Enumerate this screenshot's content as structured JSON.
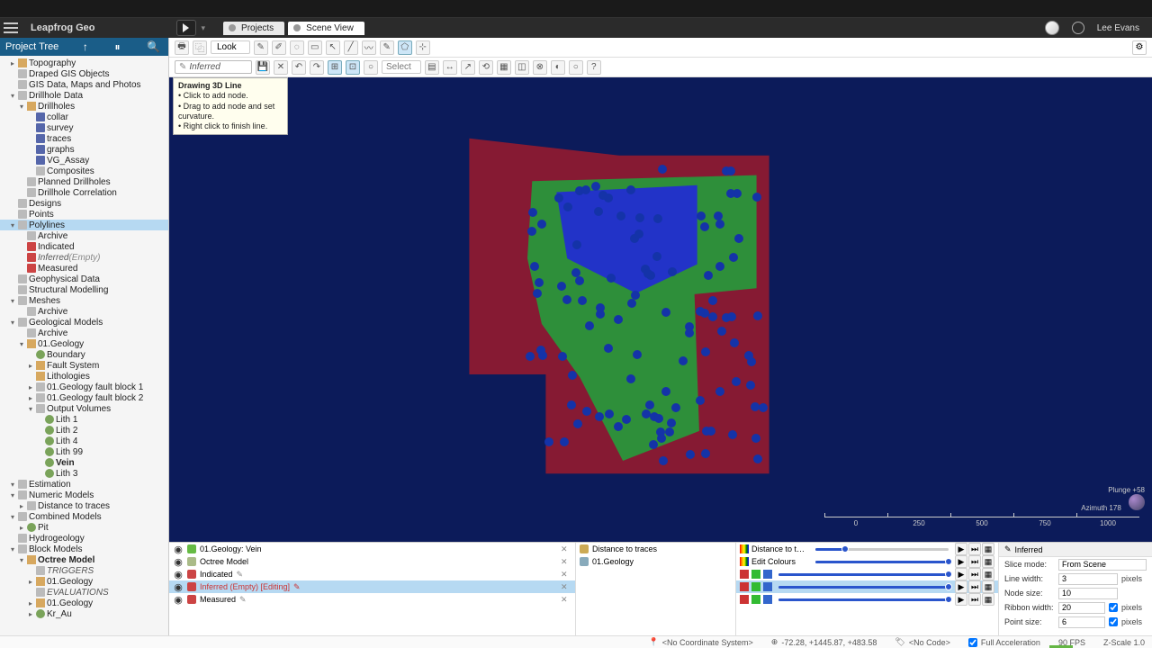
{
  "app": {
    "name": "Leapfrog Geo"
  },
  "tabs": {
    "projects": "Projects",
    "scene": "Scene View"
  },
  "user": {
    "name": "Lee Evans"
  },
  "tree": {
    "title": "Project Tree",
    "items": [
      {
        "d": 1,
        "t": "▸",
        "i": "folder",
        "l": "Topography"
      },
      {
        "d": 1,
        "t": "",
        "i": "",
        "l": "Draped GIS Objects"
      },
      {
        "d": 1,
        "t": "",
        "i": "",
        "l": "GIS Data, Maps and Photos"
      },
      {
        "d": 1,
        "t": "▾",
        "i": "",
        "l": "Drillhole Data"
      },
      {
        "d": 2,
        "t": "▾",
        "i": "folder",
        "l": "Drillholes"
      },
      {
        "d": 3,
        "t": "",
        "i": "blue",
        "l": "collar"
      },
      {
        "d": 3,
        "t": "",
        "i": "blue",
        "l": "survey"
      },
      {
        "d": 3,
        "t": "",
        "i": "blue",
        "l": "traces"
      },
      {
        "d": 3,
        "t": "",
        "i": "blue",
        "l": "graphs"
      },
      {
        "d": 3,
        "t": "",
        "i": "blue",
        "l": "VG_Assay"
      },
      {
        "d": 3,
        "t": "",
        "i": "",
        "l": "Composites"
      },
      {
        "d": 2,
        "t": "",
        "i": "",
        "l": "Planned Drillholes"
      },
      {
        "d": 2,
        "t": "",
        "i": "",
        "l": "Drillhole Correlation"
      },
      {
        "d": 1,
        "t": "",
        "i": "",
        "l": "Designs"
      },
      {
        "d": 1,
        "t": "",
        "i": "",
        "l": "Points"
      },
      {
        "d": 1,
        "t": "▾",
        "i": "",
        "l": "Polylines",
        "sel": true
      },
      {
        "d": 2,
        "t": "",
        "i": "",
        "l": "Archive"
      },
      {
        "d": 2,
        "t": "",
        "i": "line",
        "l": "Indicated"
      },
      {
        "d": 2,
        "t": "",
        "i": "line",
        "l": "Inferred",
        "suf": "(Empty)",
        "it": true
      },
      {
        "d": 2,
        "t": "",
        "i": "line",
        "l": "Measured"
      },
      {
        "d": 1,
        "t": "",
        "i": "",
        "l": "Geophysical Data"
      },
      {
        "d": 1,
        "t": "",
        "i": "",
        "l": "Structural Modelling"
      },
      {
        "d": 1,
        "t": "▾",
        "i": "",
        "l": "Meshes"
      },
      {
        "d": 2,
        "t": "",
        "i": "",
        "l": "Archive"
      },
      {
        "d": 1,
        "t": "▾",
        "i": "",
        "l": "Geological Models"
      },
      {
        "d": 2,
        "t": "",
        "i": "",
        "l": "Archive"
      },
      {
        "d": 2,
        "t": "▾",
        "i": "folder",
        "l": "01.Geology"
      },
      {
        "d": 3,
        "t": "",
        "i": "vol",
        "l": "Boundary"
      },
      {
        "d": 3,
        "t": "▸",
        "i": "folder",
        "l": "Fault System"
      },
      {
        "d": 3,
        "t": "",
        "i": "folder",
        "l": "Lithologies"
      },
      {
        "d": 3,
        "t": "▸",
        "i": "",
        "l": "01.Geology fault block 1"
      },
      {
        "d": 3,
        "t": "▸",
        "i": "",
        "l": "01.Geology fault block 2"
      },
      {
        "d": 3,
        "t": "▾",
        "i": "",
        "l": "Output Volumes"
      },
      {
        "d": 4,
        "t": "",
        "i": "vol",
        "l": "Lith 1"
      },
      {
        "d": 4,
        "t": "",
        "i": "vol",
        "l": "Lith 2"
      },
      {
        "d": 4,
        "t": "",
        "i": "vol",
        "l": "Lith 4"
      },
      {
        "d": 4,
        "t": "",
        "i": "vol",
        "l": "Lith 99"
      },
      {
        "d": 4,
        "t": "",
        "i": "vol",
        "l": "Vein",
        "bold": true
      },
      {
        "d": 4,
        "t": "",
        "i": "vol",
        "l": "Lith 3"
      },
      {
        "d": 1,
        "t": "▾",
        "i": "",
        "l": "Estimation"
      },
      {
        "d": 1,
        "t": "▾",
        "i": "",
        "l": "Numeric Models"
      },
      {
        "d": 2,
        "t": "▸",
        "i": "",
        "l": "Distance to traces"
      },
      {
        "d": 1,
        "t": "▾",
        "i": "",
        "l": "Combined Models"
      },
      {
        "d": 2,
        "t": "▸",
        "i": "vol",
        "l": "Pit"
      },
      {
        "d": 1,
        "t": "",
        "i": "",
        "l": "Hydrogeology"
      },
      {
        "d": 1,
        "t": "▾",
        "i": "",
        "l": "Block Models"
      },
      {
        "d": 2,
        "t": "▾",
        "i": "folder",
        "l": "Octree Model",
        "bold": true
      },
      {
        "d": 3,
        "t": "",
        "i": "",
        "l": "TRIGGERS",
        "it": true
      },
      {
        "d": 3,
        "t": "▸",
        "i": "folder",
        "l": "01.Geology"
      },
      {
        "d": 3,
        "t": "",
        "i": "",
        "l": "EVALUATIONS",
        "it": true
      },
      {
        "d": 3,
        "t": "▸",
        "i": "folder",
        "l": "01.Geology"
      },
      {
        "d": 3,
        "t": "▸",
        "i": "vol",
        "l": "Kr_Au"
      }
    ]
  },
  "toolbar1": {
    "look": "Look"
  },
  "toolbar2": {
    "input": "Inferred",
    "select": "Select"
  },
  "tooltip": {
    "title": "Drawing 3D Line",
    "l1": "• Click to add node.",
    "l2": "• Drag to add node and set curvature.",
    "l3": "• Right click to finish line."
  },
  "compass": {
    "plunge": "Plunge +58",
    "azimuth": "Azimuth 178"
  },
  "ruler": [
    "0",
    "250",
    "500",
    "750",
    "1000"
  ],
  "scene_list": [
    {
      "eye": "◉",
      "ic": "#6b4",
      "l": "01.Geology: Vein",
      "pen": "",
      "x": "✕"
    },
    {
      "eye": "◉",
      "ic": "#ab8",
      "l": "Octree Model",
      "pen": "",
      "x": "✕"
    },
    {
      "eye": "◉",
      "ic": "#c44",
      "l": "Indicated",
      "pen": "✎",
      "x": "✕"
    },
    {
      "eye": "◉",
      "ic": "#c44",
      "l": "Inferred (Empty) [Editing]",
      "pen": "✎",
      "x": "✕",
      "sel": true,
      "red": true
    },
    {
      "eye": "◉",
      "ic": "#c44",
      "l": "Measured",
      "pen": "✎",
      "x": "✕"
    }
  ],
  "link_list": [
    {
      "ic": "#ca5",
      "l": "Distance to traces"
    },
    {
      "ic": "#8ab",
      "l": "01.Geology"
    }
  ],
  "sliders": [
    {
      "lbl": "Distance to t…",
      "rainbow": true,
      "p": 22
    },
    {
      "lbl": "Edit Colours",
      "rainbow": true,
      "p": 100
    },
    {
      "r": "#c33",
      "g": "#3b3",
      "b": "#36c",
      "p": 100
    },
    {
      "r": "#c33",
      "g": "#3b3",
      "b": "#36c",
      "p": 100,
      "sel": true
    },
    {
      "r": "#c33",
      "g": "#3b3",
      "b": "#36c",
      "p": 100
    }
  ],
  "props": {
    "header": "Inferred",
    "slice_mode_l": "Slice mode:",
    "slice_mode_v": "From Scene",
    "line_w_l": "Line width:",
    "line_w_v": "3",
    "line_w_u": "pixels",
    "node_l": "Node size:",
    "node_v": "10",
    "ribbon_l": "Ribbon width:",
    "ribbon_v": "20",
    "ribbon_u": "pixels",
    "point_l": "Point size:",
    "point_v": "6",
    "point_u": "pixels"
  },
  "status": {
    "coord": "<No Coordinate System>",
    "pos": "-72.28, +1445.87, +483.58",
    "code": "<No Code>",
    "accel": "Full Acceleration",
    "fps": "90 FPS",
    "zscale": "Z-Scale 1.0"
  }
}
